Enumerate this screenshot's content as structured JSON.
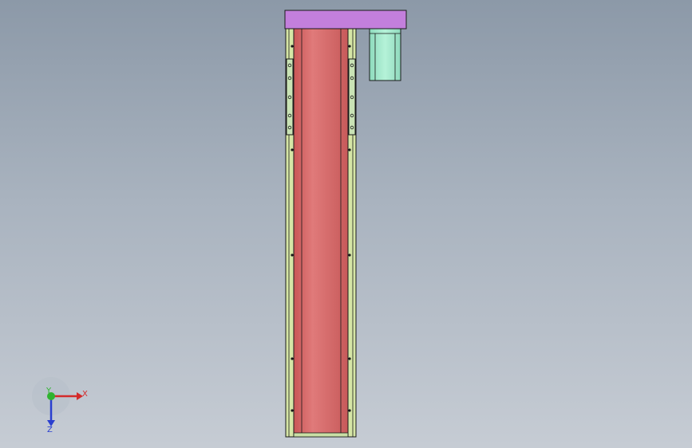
{
  "viewport": {
    "colors": {
      "background_top": "#8c99a8",
      "background_bottom": "#c6ccd4",
      "carriage": "#c37fdc",
      "rail": "#d6e6a6",
      "body": "#d96b6b",
      "body_shade": "#b24f4f",
      "motor": "#9fe6c8",
      "bracket": "#c9e3b5",
      "outline": "#1a1a1a"
    }
  },
  "triad": {
    "x_label": "X",
    "y_label": "Y",
    "z_label": "Z",
    "colors": {
      "x": "#d42a2a",
      "y": "#2fb32f",
      "z": "#2a3fcf"
    }
  }
}
